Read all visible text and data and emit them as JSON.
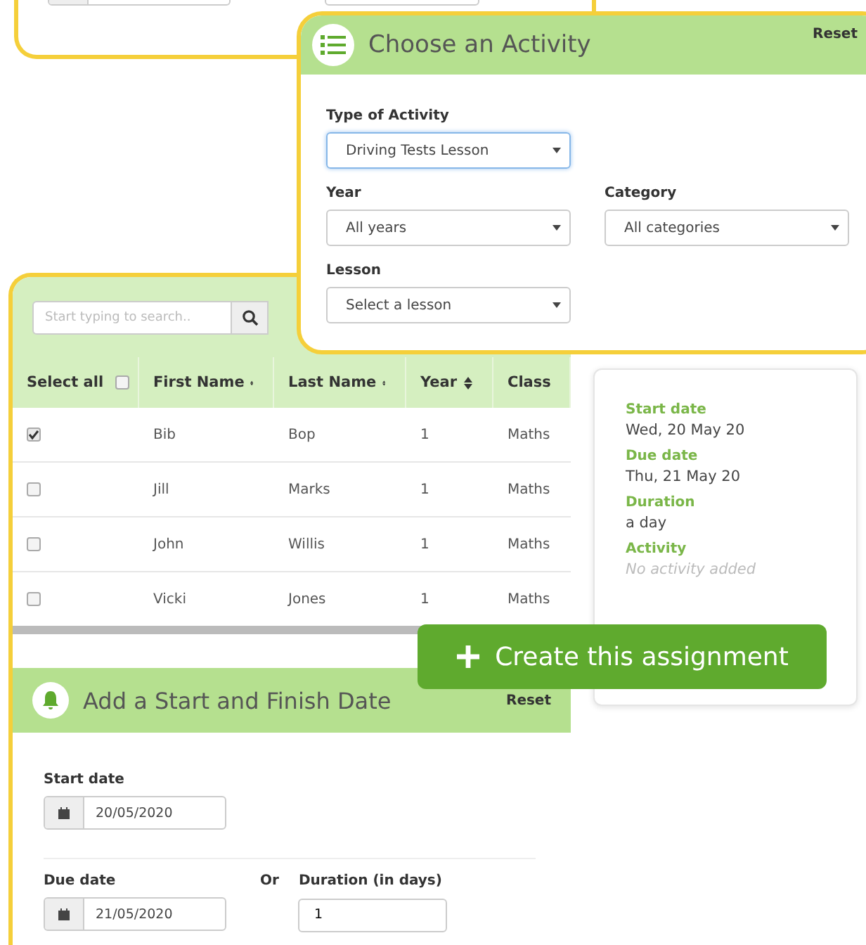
{
  "activity_panel": {
    "title": "Choose an Activity",
    "reset": "Reset",
    "type_label": "Type of Activity",
    "type_value": "Driving Tests Lesson",
    "year_label": "Year",
    "year_value": "All years",
    "category_label": "Category",
    "category_value": "All categories",
    "lesson_label": "Lesson",
    "lesson_value": "Select a lesson"
  },
  "students": {
    "search_placeholder": "Start typing to search..",
    "select_all_checked": false,
    "columns": [
      {
        "label": "Select all",
        "kind": "checkbox"
      },
      {
        "label": "First Name",
        "kind": "sort"
      },
      {
        "label": "Last Name",
        "kind": "sort"
      },
      {
        "label": "Year",
        "kind": "sort"
      },
      {
        "label": "Class",
        "kind": "plain"
      }
    ],
    "rows": [
      {
        "checked": true,
        "first_name": "Bib",
        "last_name": "Bop",
        "year": "1",
        "class": "Maths"
      },
      {
        "checked": false,
        "first_name": "Jill",
        "last_name": "Marks",
        "year": "1",
        "class": "Maths"
      },
      {
        "checked": false,
        "first_name": "John",
        "last_name": "Willis",
        "year": "1",
        "class": "Maths"
      },
      {
        "checked": false,
        "first_name": "Vicki",
        "last_name": "Jones",
        "year": "1",
        "class": "Maths"
      }
    ]
  },
  "summary": {
    "items": [
      {
        "label": "Start date",
        "value": "Wed, 20 May 20",
        "kind": "value"
      },
      {
        "label": "Due date",
        "value": "Thu, 21 May 20",
        "kind": "value"
      },
      {
        "label": "Duration",
        "value": "a day",
        "kind": "value"
      },
      {
        "label": "Activity",
        "value": "No activity added",
        "kind": "empty"
      }
    ]
  },
  "create_button": "Create this assignment",
  "dates_panel": {
    "title": "Add a Start and Finish Date",
    "reset": "Reset",
    "start_label": "Start date",
    "start_value": "20/05/2020",
    "due_label": "Due date",
    "due_value": "21/05/2020",
    "or": "Or",
    "duration_label": "Duration (in days)",
    "duration_value": "1"
  }
}
